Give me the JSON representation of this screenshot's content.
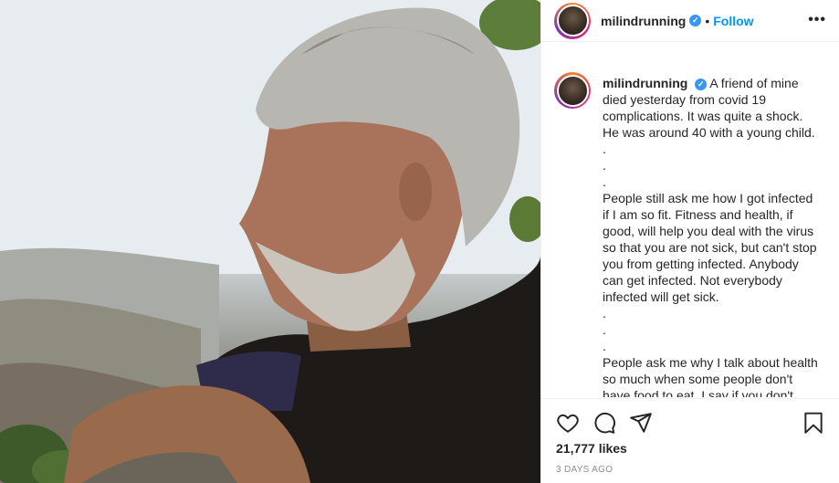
{
  "post": {
    "photo_alt": "",
    "username": "milindrunning",
    "verified_mark": "✓",
    "separator": "•",
    "follow_label": "Follow",
    "more_label": "•••"
  },
  "caption": {
    "username": "milindrunning",
    "text": "A friend of mine died yesterday from covid 19 complications. It was quite a shock. He was around 40 with a young child.\n.\n.\n.\nPeople still ask me how I got infected if I am so fit. Fitness and health, if good, will help you deal with the virus so that you are not sick, but can't stop you from getting infected. Anybody can get infected. Not everybody infected will get sick.\n.\n.\n.\nPeople ask me why I talk about health so much when some people don't have food to eat. I say if you don't"
  },
  "actions": {
    "like_icon": "heart-icon",
    "comment_icon": "comment-icon",
    "share_icon": "paper-plane-icon",
    "save_icon": "bookmark-icon"
  },
  "stats": {
    "likes": "21,777 likes",
    "date": "3 DAYS AGO"
  }
}
